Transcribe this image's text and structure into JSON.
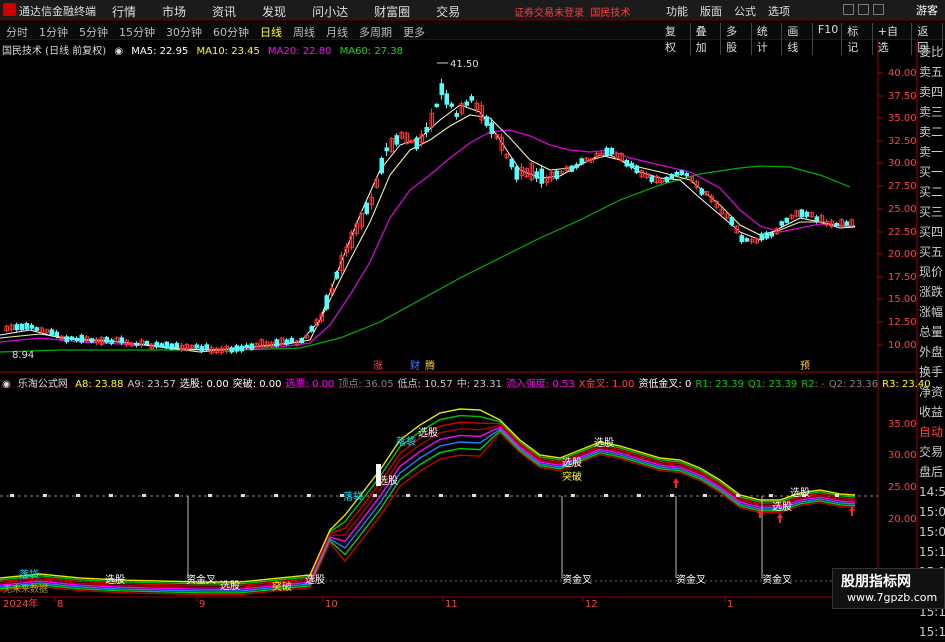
{
  "titlebar": {
    "app_name": "通达信金融终端",
    "menu": [
      "行情",
      "市场",
      "资讯",
      "发现",
      "问小达",
      "财富圈",
      "交易"
    ],
    "notice_trade": "证券交易未登录",
    "notice_stock": "国民技术",
    "right_menu": [
      "功能",
      "版面",
      "公式",
      "选项"
    ],
    "guest": "游客"
  },
  "periodbar": {
    "periods": [
      "分时",
      "1分钟",
      "5分钟",
      "15分钟",
      "30分钟",
      "60分钟",
      "日线",
      "周线",
      "月线",
      "多周期",
      "更多"
    ],
    "active_period": "日线",
    "tools": [
      "复权",
      "叠加",
      "多股",
      "统计",
      "画线",
      "F10",
      "标记",
      "+自选",
      "返回"
    ]
  },
  "main_chart": {
    "title": "国民技术 (日线 前复权)",
    "ma5_label": "MA5: 22.95",
    "ma10_label": "MA10: 23.45",
    "ma20_label": "MA20: 22.80",
    "ma60_label": "MA60: 27.38",
    "price_ticks": [
      "40.00",
      "37.50",
      "35.00",
      "32.50",
      "30.00",
      "27.50",
      "25.00",
      "22.50",
      "20.00",
      "17.50",
      "15.00",
      "12.50",
      "10.00"
    ],
    "high_label": "41.50",
    "low_label": "8.94",
    "event_marks": [
      "涨",
      "财",
      "腾",
      "预"
    ]
  },
  "sub_chart": {
    "indicator": "乐淘公式网",
    "legend": [
      {
        "text": "A8: 23.88",
        "color": "#ffff00"
      },
      {
        "text": "A9: 23.57",
        "color": "#c8c8c8"
      },
      {
        "text": "选股: 0.00",
        "color": "#ffffff"
      },
      {
        "text": "突破: 0.00",
        "color": "#ffffff"
      },
      {
        "text": "选票: 0.00",
        "color": "#ff00ff"
      },
      {
        "text": "顶点: 36.05",
        "color": "#808080"
      },
      {
        "text": "低点: 10.57",
        "color": "#c8c8c8"
      },
      {
        "text": "中: 23.31",
        "color": "#c8c8c8"
      },
      {
        "text": "流入强度: 0.53",
        "color": "#ff00ff"
      },
      {
        "text": "X金叉: 1.00",
        "color": "#ff4040"
      },
      {
        "text": "资低金叉: 0",
        "color": "#ffffff"
      },
      {
        "text": "R1: 23.39",
        "color": "#00cc00"
      },
      {
        "text": "Q1: 23.39",
        "color": "#00cc00"
      },
      {
        "text": "R2: -",
        "color": "#00cc00"
      },
      {
        "text": "Q2: 23.36",
        "color": "#808080"
      },
      {
        "text": "R3: 23.40",
        "color": "#ffff00"
      }
    ],
    "ticks": [
      "35.00",
      "30.00",
      "25.00",
      "20.00"
    ],
    "notes": [
      "无未来数据"
    ],
    "labels": [
      "落袋",
      "选股",
      "资金叉",
      "选股",
      "突破",
      "选股",
      "落袋",
      "选股",
      "落袋",
      "选股",
      "选股",
      "突破",
      "选股",
      "资金叉",
      "资金叉",
      "选股",
      "选股",
      "资金叉"
    ]
  },
  "time_axis": [
    "2024年",
    "8",
    "9",
    "10",
    "11",
    "12",
    "1"
  ],
  "right_panel": {
    "quote_items": [
      "委比",
      "卖五",
      "卖四",
      "卖三",
      "卖二",
      "卖一",
      "买一",
      "买二",
      "买三",
      "买四",
      "买五",
      "现价",
      "涨跌",
      "涨幅",
      "总量",
      "外盘",
      "换手",
      "净资",
      "收益"
    ],
    "lower_items": [
      "自动",
      "交易",
      "盘后",
      "14:57",
      "15:00",
      "15:07",
      "15:12",
      "15:12",
      "15:12",
      "15:13",
      "15:16"
    ]
  },
  "watermark": {
    "line1": "股朋指标网",
    "line2": "www.7gpzb.com"
  }
}
